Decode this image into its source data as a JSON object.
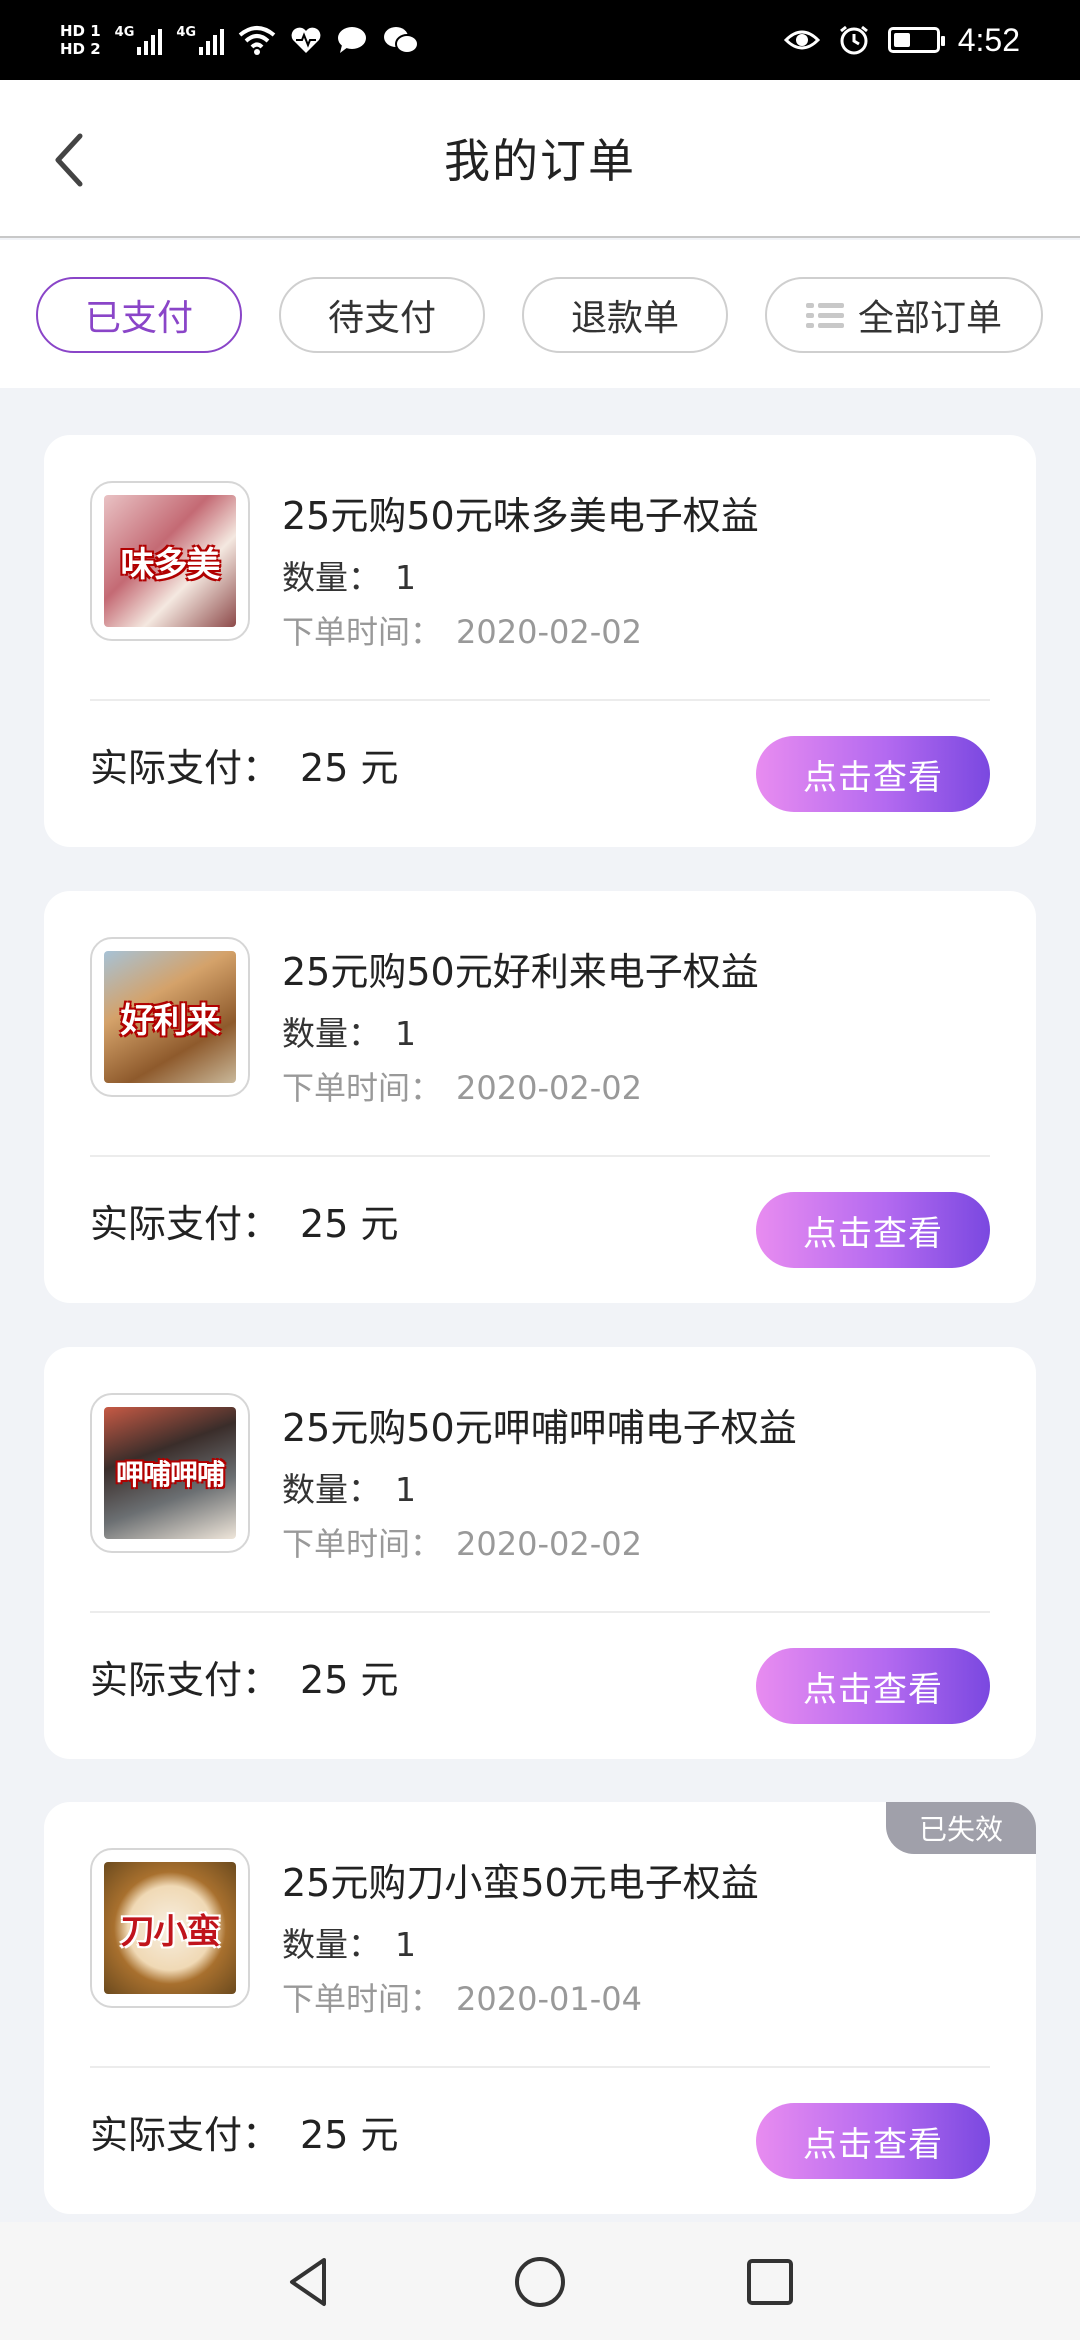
{
  "status_bar": {
    "hd1": "HD 1",
    "hd2": "HD 2",
    "net1": "4G",
    "net2": "4G",
    "time": "4:52"
  },
  "header": {
    "title": "我的订单"
  },
  "tabs": [
    {
      "label": "已支付",
      "active": true
    },
    {
      "label": "待支付",
      "active": false
    },
    {
      "label": "退款单",
      "active": false
    },
    {
      "label": "全部订单",
      "active": false
    }
  ],
  "labels": {
    "qty": "数量：",
    "order_time": "下单时间：",
    "paid": "实际支付：",
    "view_button": "点击查看"
  },
  "orders": [
    {
      "title": "25元购50元味多美电子权益",
      "qty": "1",
      "time": "2020-02-02",
      "paid": "25 元",
      "thumb_text": "味多美",
      "badge": ""
    },
    {
      "title": "25元购50元好利来电子权益",
      "qty": "1",
      "time": "2020-02-02",
      "paid": "25 元",
      "thumb_text": "好利来",
      "badge": ""
    },
    {
      "title": "25元购50元呷哺呷哺电子权益",
      "qty": "1",
      "time": "2020-02-02",
      "paid": "25 元",
      "thumb_text": "呷哺呷哺",
      "badge": ""
    },
    {
      "title": "25元购刀小蛮50元电子权益",
      "qty": "1",
      "time": "2020-01-04",
      "paid": "25 元",
      "thumb_text": "刀小蛮",
      "badge": "已失效"
    }
  ],
  "colors": {
    "accent": "#8a45c8",
    "button_gradient_start": "#e88cf0",
    "button_gradient_end": "#7a48e0",
    "background": "#f1f3f7",
    "badge": "#a0a0aa"
  }
}
